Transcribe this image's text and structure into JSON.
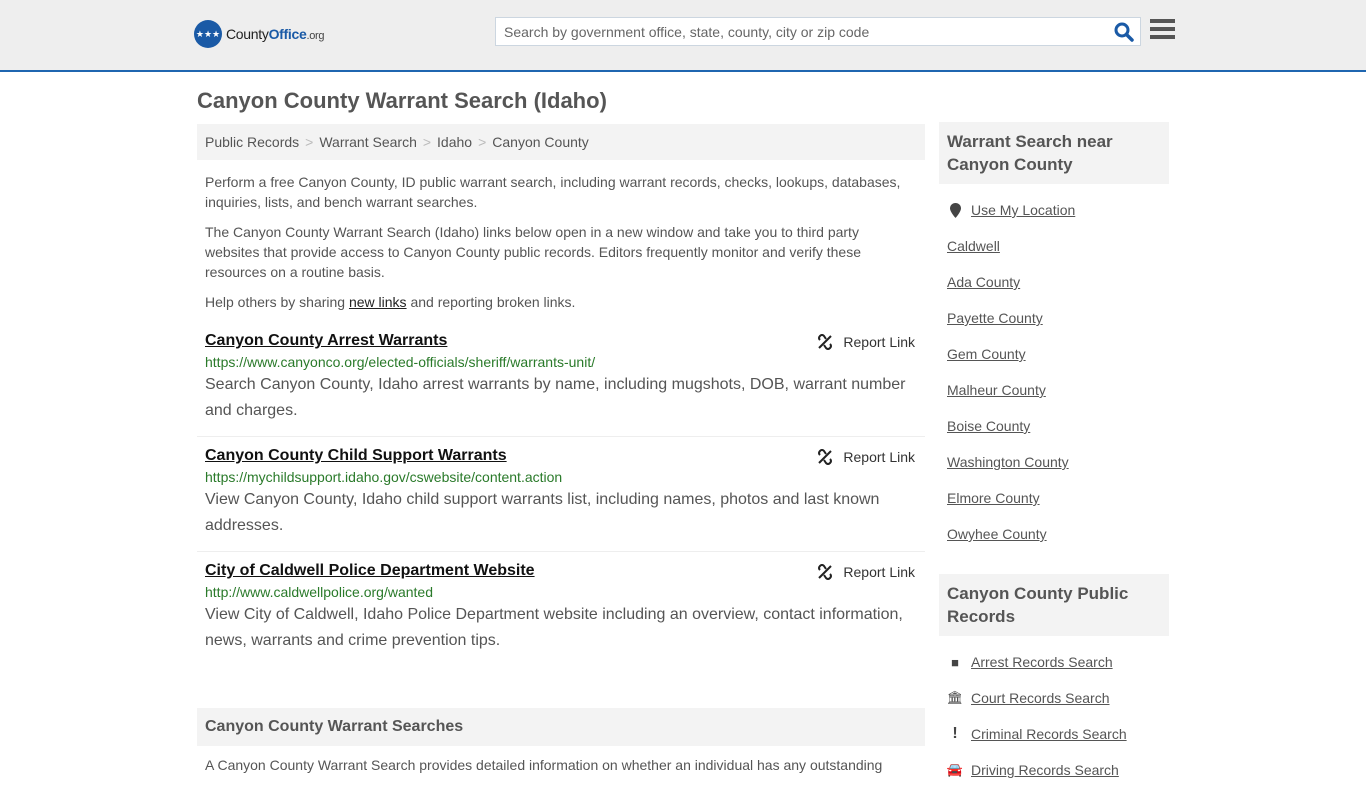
{
  "header": {
    "logo_county": "County",
    "logo_office": "Office",
    "logo_org": ".org",
    "search_placeholder": "Search by government office, state, county, city or zip code",
    "search_icon": "search-icon",
    "menu_icon": "hamburger-menu-icon"
  },
  "page": {
    "title": "Canyon County Warrant Search (Idaho)"
  },
  "breadcrumb": [
    "Public Records",
    "Warrant Search",
    "Idaho",
    "Canyon County"
  ],
  "intro": {
    "p1": "Perform a free Canyon County, ID public warrant search, including warrant records, checks, lookups, databases, inquiries, lists, and bench warrant searches.",
    "p2": "The Canyon County Warrant Search (Idaho) links below open in a new window and take you to third party websites that provide access to Canyon County public records. Editors frequently monitor and verify these resources on a routine basis.",
    "p3_before": "Help others by sharing ",
    "p3_link": "new links",
    "p3_after": " and reporting broken links."
  },
  "report_label": "Report Link",
  "entries": [
    {
      "title": "Canyon County Arrest Warrants",
      "url": "https://www.canyonco.org/elected-officials/sheriff/warrants-unit/",
      "desc": "Search Canyon County, Idaho arrest warrants by name, including mugshots, DOB, warrant number and charges."
    },
    {
      "title": "Canyon County Child Support Warrants",
      "url": "https://mychildsupport.idaho.gov/cswebsite/content.action",
      "desc": "View Canyon County, Idaho child support warrants list, including names, photos and last known addresses."
    },
    {
      "title": "City of Caldwell Police Department Website",
      "url": "http://www.caldwellpolice.org/wanted",
      "desc": "View City of Caldwell, Idaho Police Department website including an overview, contact information, news, warrants and crime prevention tips."
    }
  ],
  "searches_section": {
    "heading": "Canyon County Warrant Searches",
    "text": "A Canyon County Warrant Search provides detailed information on whether an individual has any outstanding"
  },
  "sidebar": {
    "nearby_heading": "Warrant Search near Canyon County",
    "use_location": "Use My Location",
    "nearby": [
      "Caldwell",
      "Ada County",
      "Payette County",
      "Gem County",
      "Malheur County",
      "Boise County",
      "Washington County",
      "Elmore County",
      "Owyhee County"
    ],
    "records_heading": "Canyon County Public Records",
    "records": [
      {
        "label": "Arrest Records Search",
        "icon": "square-icon"
      },
      {
        "label": "Court Records Search",
        "icon": "courthouse-icon"
      },
      {
        "label": "Criminal Records Search",
        "icon": "exclamation-icon"
      },
      {
        "label": "Driving Records Search",
        "icon": "car-icon"
      }
    ]
  }
}
